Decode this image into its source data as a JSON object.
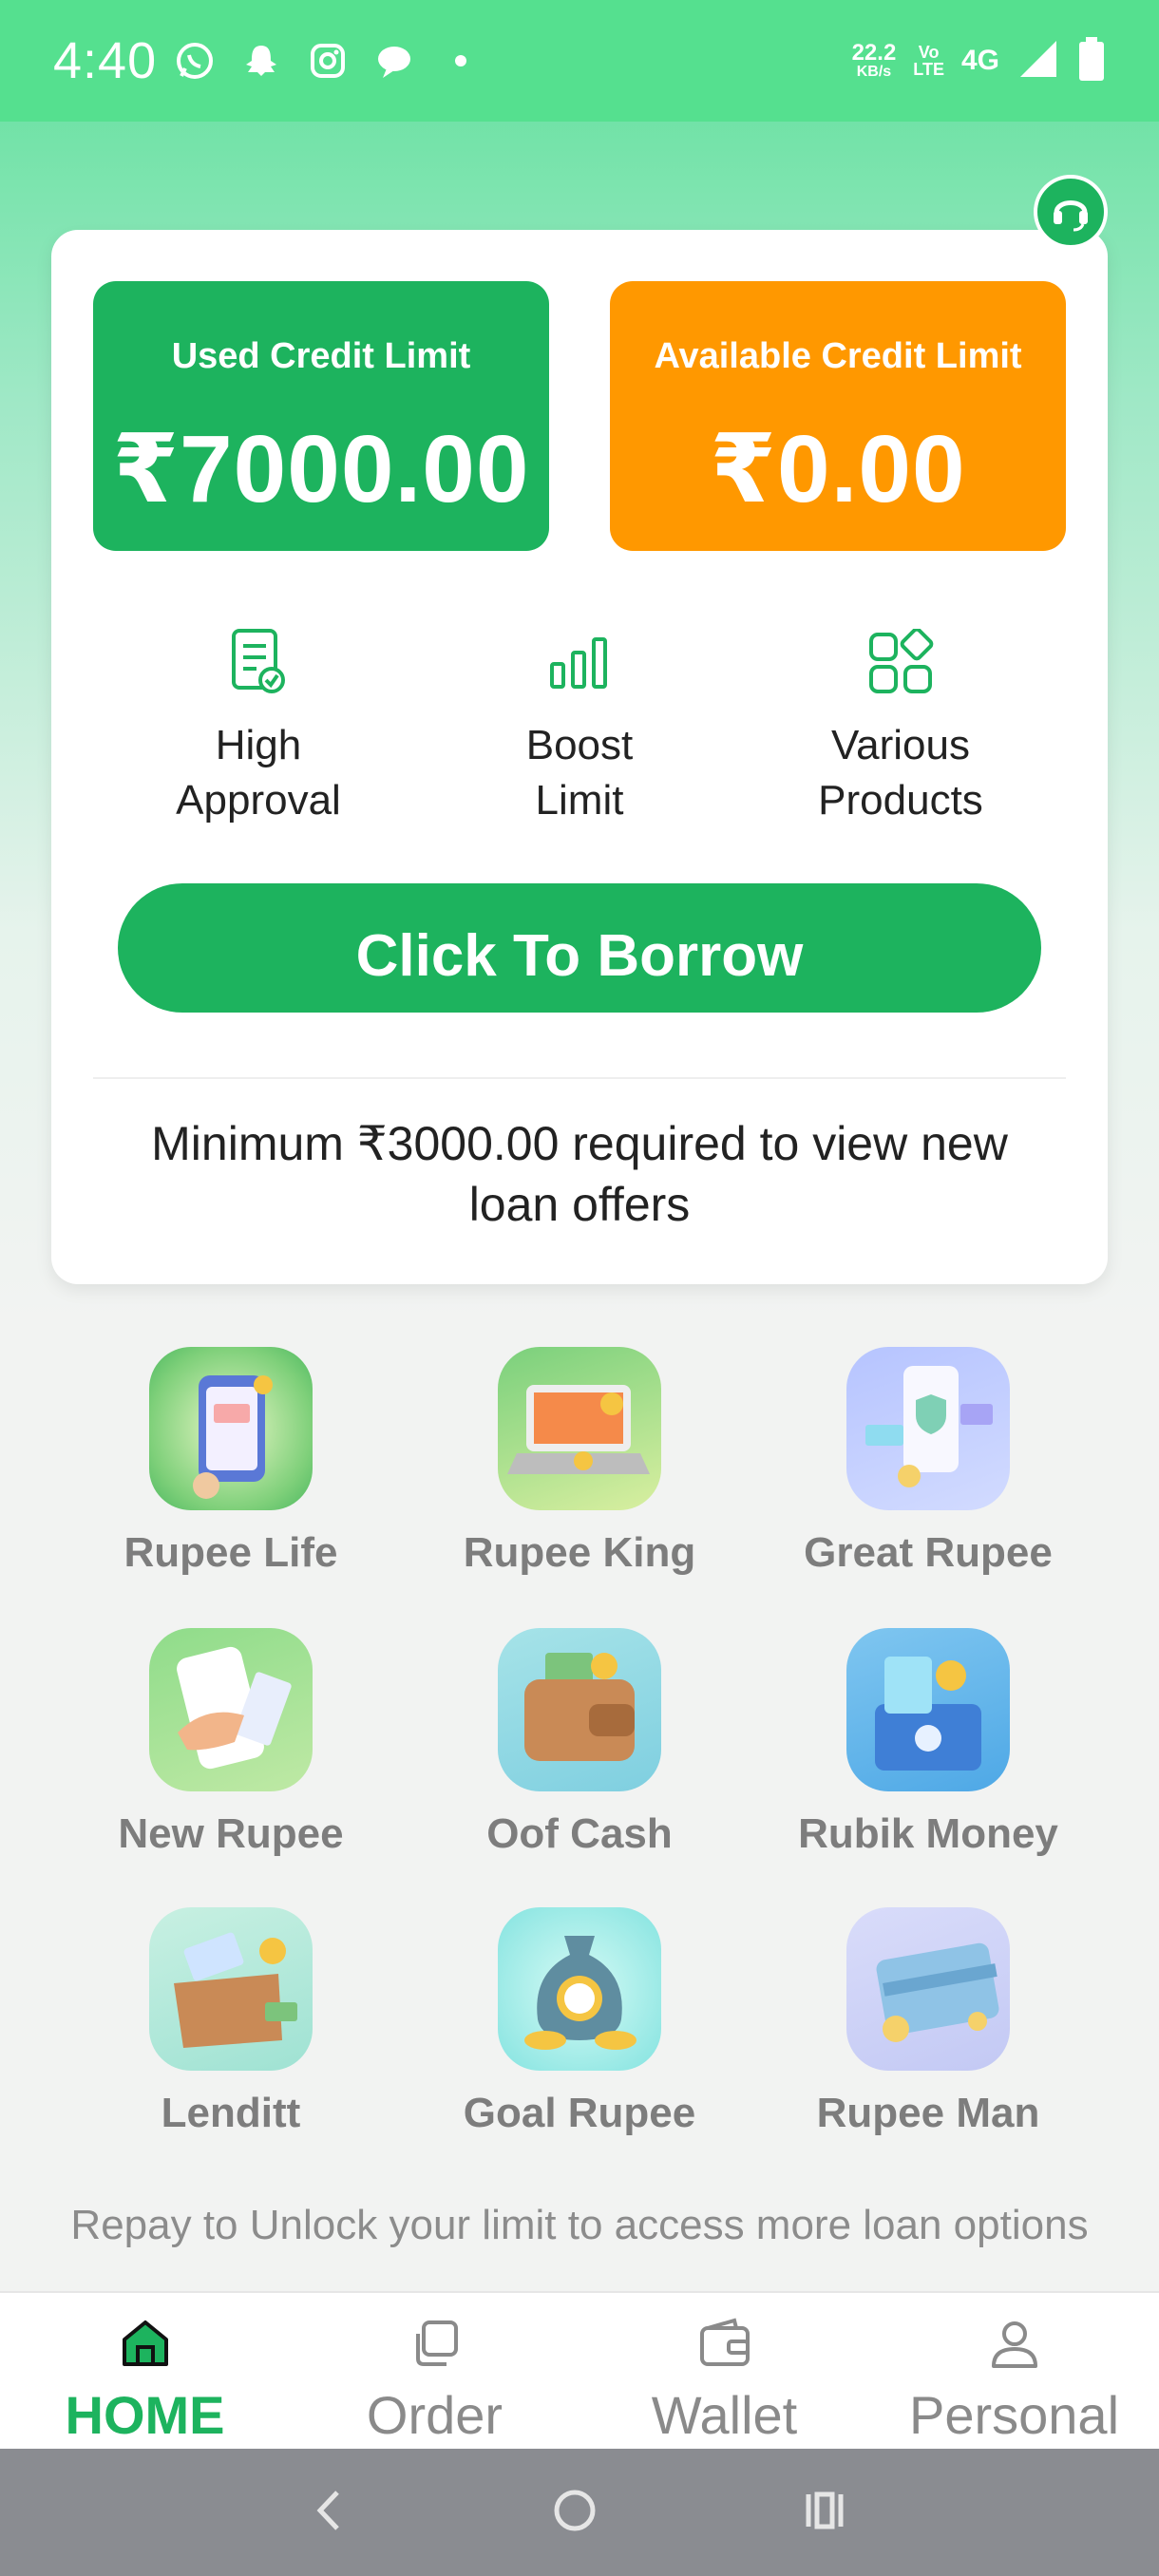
{
  "status_bar": {
    "time": "4:40",
    "speed_value": "22.2",
    "speed_unit": "KB/s",
    "volte_top": "Vo",
    "volte_bottom": "LTE",
    "network": "4G",
    "left_icons": [
      "whatsapp-icon",
      "snapchat-icon",
      "instagram-icon",
      "messages-icon",
      "dot-icon"
    ]
  },
  "card": {
    "used": {
      "label": "Used Credit Limit",
      "value": "₹7000.00"
    },
    "available": {
      "label": "Available Credit Limit",
      "value": "₹0.00"
    },
    "features": [
      {
        "line1": "High",
        "line2": "Approval",
        "icon": "document-check-icon"
      },
      {
        "line1": "Boost",
        "line2": "Limit",
        "icon": "bar-chart-icon"
      },
      {
        "line1": "Various",
        "line2": "Products",
        "icon": "grid-shapes-icon"
      }
    ],
    "borrow_button": "Click To Borrow",
    "min_note": "Minimum ₹3000.00 required to view new loan offers"
  },
  "apps": [
    {
      "name": "Rupee Life"
    },
    {
      "name": "Rupee King"
    },
    {
      "name": "Great Rupee"
    },
    {
      "name": "New Rupee"
    },
    {
      "name": "Oof Cash"
    },
    {
      "name": "Rubik Money"
    },
    {
      "name": "Lenditt"
    },
    {
      "name": "Goal Rupee"
    },
    {
      "name": "Rupee Man"
    }
  ],
  "repay_note": "Repay to Unlock your limit to access more loan options",
  "bottom_nav": {
    "items": [
      {
        "label": "HOME",
        "icon": "home-icon",
        "active": true
      },
      {
        "label": "Order",
        "icon": "order-icon",
        "active": false
      },
      {
        "label": "Wallet",
        "icon": "wallet-icon",
        "active": false
      },
      {
        "label": "Personal",
        "icon": "person-icon",
        "active": false
      }
    ]
  },
  "colors": {
    "primary_green": "#1db35e",
    "orange": "#ff9800",
    "status_bar": "#55e08f"
  }
}
